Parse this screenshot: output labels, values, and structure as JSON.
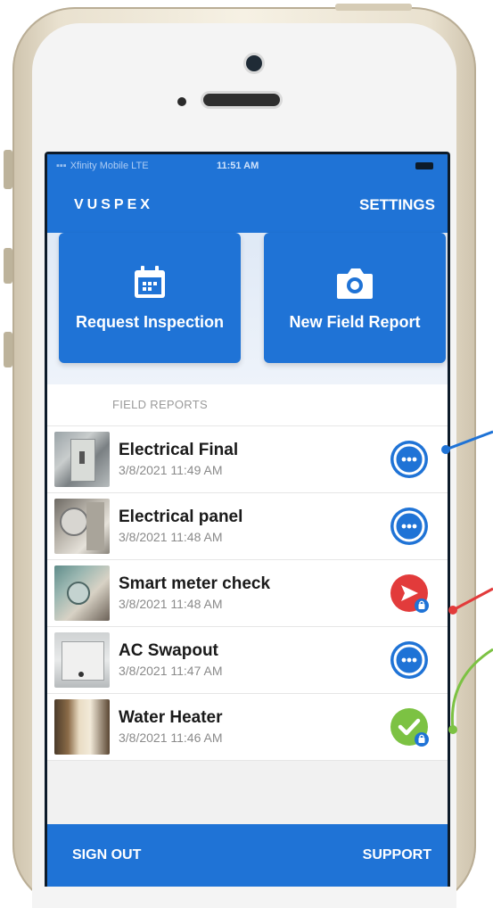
{
  "status_bar": {
    "carrier": "Xfinity Mobile  LTE",
    "time": "11:51 AM"
  },
  "header": {
    "logo": "VUSPEX",
    "settings_label": "SETTINGS"
  },
  "actions": {
    "request_inspection": "Request Inspection",
    "new_field_report": "New Field Report"
  },
  "section_title": "FIELD REPORTS",
  "reports": [
    {
      "title": "Electrical Final",
      "date": "3/8/2021 11:49 AM",
      "status": "pending",
      "icon": "more-icon"
    },
    {
      "title": "Electrical panel",
      "date": "3/8/2021 11:48 AM",
      "status": "pending",
      "icon": "more-icon"
    },
    {
      "title": "Smart meter check",
      "date": "3/8/2021 11:48 AM",
      "status": "sending",
      "icon": "send-icon"
    },
    {
      "title": "AC Swapout",
      "date": "3/8/2021 11:47 AM",
      "status": "pending",
      "icon": "more-icon"
    },
    {
      "title": "Water Heater",
      "date": "3/8/2021 11:46 AM",
      "status": "complete",
      "icon": "check-icon"
    }
  ],
  "footer": {
    "sign_out": "SIGN OUT",
    "support": "SUPPORT"
  },
  "colors": {
    "primary": "#1f73d6",
    "pending": "#1f73d6",
    "sending": "#e23b3b",
    "complete": "#7cc243",
    "annotation_blue": "#1f73d6",
    "annotation_red": "#e23b3b",
    "annotation_green": "#7cc243"
  }
}
